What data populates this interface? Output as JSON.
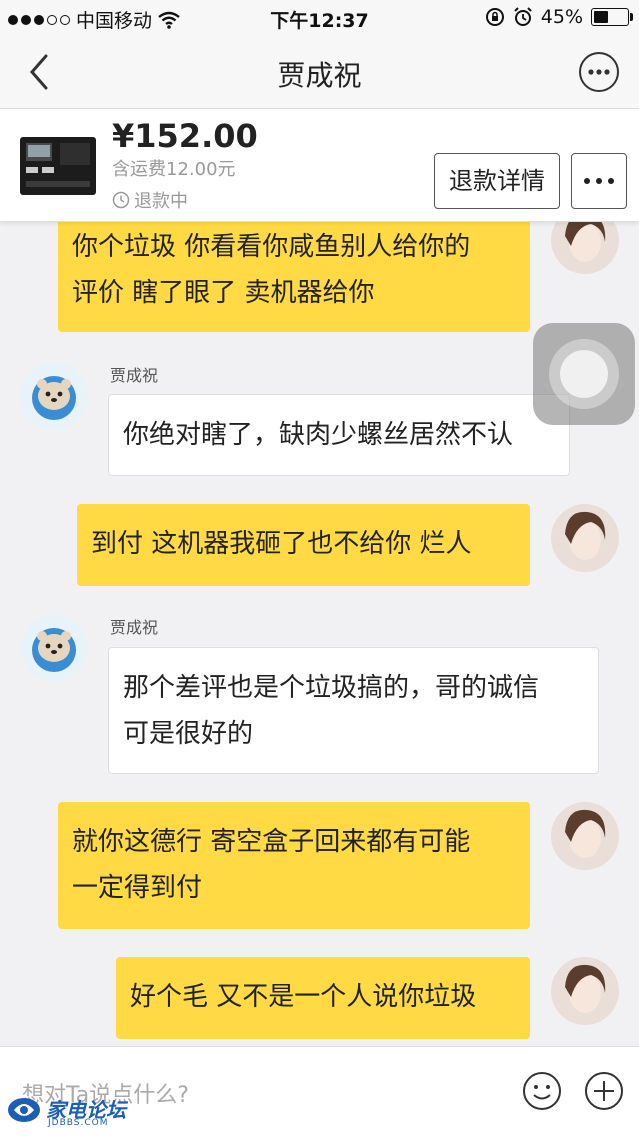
{
  "status_bar": {
    "carrier": "中国移动",
    "time": "下午12:37",
    "battery_percent": "45%",
    "battery_level": 0.45
  },
  "nav": {
    "title": "贾成祝"
  },
  "product": {
    "price": "¥152.00",
    "shipping": "含运费12.00元",
    "status": "退款中",
    "refund_button": "退款详情"
  },
  "messages": [
    {
      "side": "mine",
      "lines": [
        "你个垃圾 你看看你咸鱼别人给你的",
        "评价 瞎了眼了 卖机器给你"
      ]
    },
    {
      "side": "theirs",
      "sender": "贾成祝",
      "lines": [
        "你绝对瞎了，缺肉少螺丝居然不认"
      ]
    },
    {
      "side": "mine",
      "lines": [
        "到付 这机器我砸了也不给你 烂人"
      ]
    },
    {
      "side": "theirs",
      "sender": "贾成祝",
      "lines": [
        "那个差评也是个垃圾搞的，哥的诚信",
        "可是很好的"
      ]
    },
    {
      "side": "mine",
      "lines": [
        "就你这德行 寄空盒子回来都有可能",
        "一定得到付"
      ]
    },
    {
      "side": "mine",
      "lines": [
        "好个毛 又不是一个人说你垃圾"
      ]
    }
  ],
  "input": {
    "placeholder": "想对Ta说点什么?"
  },
  "watermark": {
    "text": "家电论坛",
    "sub": "JDBBS.COM"
  },
  "colors": {
    "my_bubble": "#ffda44",
    "their_bubble": "#ffffff",
    "background": "#f1f1f3"
  }
}
